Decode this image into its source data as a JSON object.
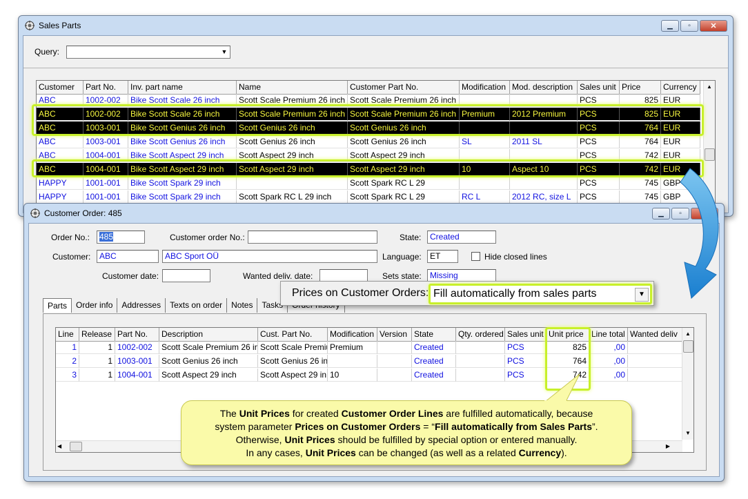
{
  "sales_parts": {
    "title": "Sales Parts",
    "query_label": "Query:",
    "query_value": "",
    "columns": [
      "Customer",
      "Part No.",
      "Inv. part name",
      "Name",
      "Customer Part No.",
      "Modification",
      "Mod. description",
      "Sales unit",
      "Price",
      "Currency"
    ],
    "rows": [
      {
        "customer": "ABC",
        "part_no": "1002-002",
        "inv_part_name": "Bike Scott Scale 26 inch",
        "name": "Scott Scale Premium 26 inch",
        "customer_part_no": "Scott Scale Premium 26 inch",
        "modification": "",
        "mod_description": "",
        "sales_unit": "PCS",
        "price": "825",
        "currency": "EUR",
        "selected": false
      },
      {
        "customer": "ABC",
        "part_no": "1002-002",
        "inv_part_name": "Bike Scott Scale 26 inch",
        "name": "Scott Scale Premium 26 inch",
        "customer_part_no": "Scott Scale Premium 26 inch",
        "modification": "Premium",
        "mod_description": "2012 Premium",
        "sales_unit": "PCS",
        "price": "825",
        "currency": "EUR",
        "selected": true
      },
      {
        "customer": "ABC",
        "part_no": "1003-001",
        "inv_part_name": "Bike Scott Genius 26 inch",
        "name": "Scott Genius 26 inch",
        "customer_part_no": "Scott Genius 26 inch",
        "modification": "",
        "mod_description": "",
        "sales_unit": "PCS",
        "price": "764",
        "currency": "EUR",
        "selected": true
      },
      {
        "customer": "ABC",
        "part_no": "1003-001",
        "inv_part_name": "Bike Scott Genius 26 inch",
        "name": "Scott Genius 26 inch",
        "customer_part_no": "Scott Genius 26 inch",
        "modification": "SL",
        "mod_description": "2011 SL",
        "sales_unit": "PCS",
        "price": "764",
        "currency": "EUR",
        "selected": false
      },
      {
        "customer": "ABC",
        "part_no": "1004-001",
        "inv_part_name": "Bike Scott Aspect 29 inch",
        "name": "Scott Aspect 29 inch",
        "customer_part_no": "Scott Aspect 29 inch",
        "modification": "",
        "mod_description": "",
        "sales_unit": "PCS",
        "price": "742",
        "currency": "EUR",
        "selected": false
      },
      {
        "customer": "ABC",
        "part_no": "1004-001",
        "inv_part_name": "Bike Scott Aspect 29 inch",
        "name": "Scott Aspect 29 inch",
        "customer_part_no": "Scott Aspect 29 inch",
        "modification": "10",
        "mod_description": "Aspect 10",
        "sales_unit": "PCS",
        "price": "742",
        "currency": "EUR",
        "selected": true
      },
      {
        "customer": "HAPPY",
        "part_no": "1001-001",
        "inv_part_name": "Bike Scott Spark 29 inch",
        "name": "",
        "customer_part_no": "Scott Spark RC L 29",
        "modification": "",
        "mod_description": "",
        "sales_unit": "PCS",
        "price": "745",
        "currency": "GBP",
        "selected": false
      },
      {
        "customer": "HAPPY",
        "part_no": "1001-001",
        "inv_part_name": "Bike Scott Spark 29 inch",
        "name": "Scott Spark RC L 29 inch",
        "customer_part_no": "Scott Spark RC L 29",
        "modification": "RC L",
        "mod_description": "2012 RC, size L",
        "sales_unit": "PCS",
        "price": "745",
        "currency": "GBP",
        "selected": false
      }
    ]
  },
  "customer_order": {
    "title": "Customer Order: 485",
    "order_no_label": "Order No.:",
    "order_no": "485",
    "customer_order_no_label": "Customer order No.:",
    "customer_order_no": "",
    "state_label": "State:",
    "state": "Created",
    "customer_label": "Customer:",
    "customer": "ABC",
    "customer_name": "ABC Sport OÜ",
    "language_label": "Language:",
    "language": "ET",
    "hide_closed_label": "Hide closed lines",
    "customer_date_label": "Customer date:",
    "customer_date": "",
    "wanted_deliv_label": "Wanted deliv. date:",
    "sets_state_label": "Sets state:",
    "sets_state": "Missing",
    "tabs": [
      "Parts",
      "Order info",
      "Addresses",
      "Texts on order",
      "Notes",
      "Tasks",
      "Order history"
    ],
    "columns": [
      "Line",
      "Release",
      "Part No.",
      "Description",
      "Cust. Part No.",
      "Modification",
      "Version",
      "State",
      "Qty. ordered",
      "Sales unit",
      "Unit price",
      "Line total",
      "Wanted deliv"
    ],
    "rows": [
      {
        "line": "1",
        "release": "1",
        "part_no": "1002-002",
        "description": "Scott Scale Premium 26 inc",
        "cust_part_no": "Scott Scale Premiu",
        "modification": "Premium",
        "version": "",
        "state": "Created",
        "qty": "",
        "sales_unit": "PCS",
        "unit_price": "825",
        "line_total": ",00",
        "wanted": ""
      },
      {
        "line": "2",
        "release": "1",
        "part_no": "1003-001",
        "description": "Scott Genius 26 inch",
        "cust_part_no": "Scott Genius 26 in",
        "modification": "",
        "version": "",
        "state": "Created",
        "qty": "",
        "sales_unit": "PCS",
        "unit_price": "764",
        "line_total": ",00",
        "wanted": ""
      },
      {
        "line": "3",
        "release": "1",
        "part_no": "1004-001",
        "description": "Scott Aspect 29 inch",
        "cust_part_no": "Scott Aspect 29 in",
        "modification": "10",
        "version": "",
        "state": "Created",
        "qty": "",
        "sales_unit": "PCS",
        "unit_price": "742",
        "line_total": ",00",
        "wanted": ""
      }
    ]
  },
  "param_popup": {
    "label": "Prices on Customer Orders:",
    "value": "Fill automatically from sales parts"
  },
  "callout": {
    "l1": [
      "The ",
      "Unit Prices",
      " for created ",
      "Customer Order Lines",
      " are fulfilled automatically, because"
    ],
    "l2": [
      "system parameter ",
      "Prices on Customer Orders",
      " = “",
      "Fill automatically from Sales Parts",
      "”."
    ],
    "l3": [
      "Otherwise, ",
      "Unit Prices",
      " should be fulfilled by special option or entered manually."
    ],
    "l4": [
      "In any cases, ",
      "Unit Prices",
      " can be changed (as well as a related ",
      "Currency",
      "). "
    ]
  },
  "colors": {
    "highlight": "#c8f02a",
    "link_text": "#1010e0",
    "callout_bg": "#fafaa9",
    "arrow": "#2b93d8"
  },
  "icons": [
    "app-icon",
    "minimize-icon",
    "maximize-icon",
    "close-icon",
    "dropdown-arrow-icon",
    "curved-arrow-icon"
  ]
}
